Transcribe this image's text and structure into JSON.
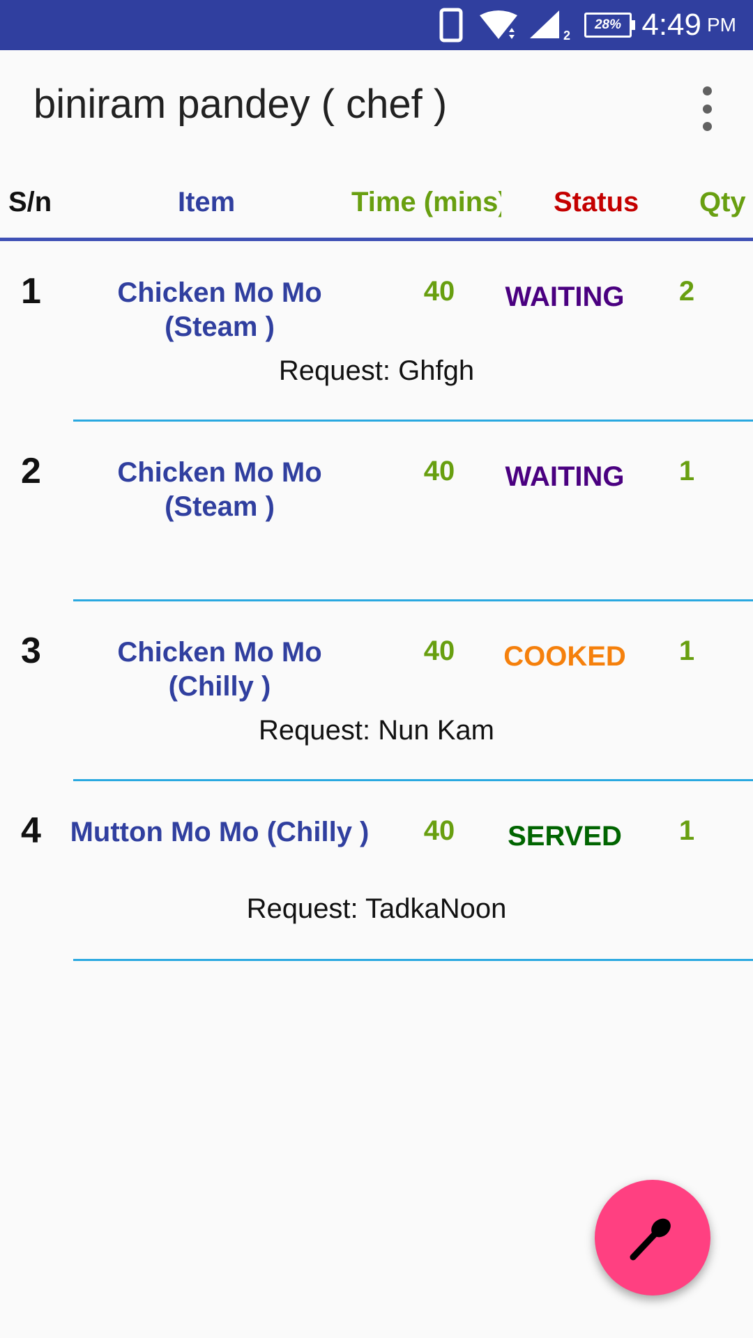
{
  "status_bar": {
    "battery": "28%",
    "time": "4:49",
    "ampm": "PM",
    "signal_sub": "2",
    "bg_color": "#303F9F"
  },
  "app_bar": {
    "title": "biniram pandey ( chef )",
    "overflow_icon": "more-vert-icon"
  },
  "table": {
    "headers": {
      "sn": "S/n",
      "item": "Item",
      "time": "Time (mins)",
      "status": "Status",
      "qty": "Qty"
    },
    "header_colors": {
      "sn": "#111111",
      "item": "#303F9F",
      "time": "#689F10",
      "status": "#C40000",
      "qty": "#689F10"
    },
    "rows": [
      {
        "sn": "1",
        "item_line1": "Chicken Mo Mo",
        "item_line2": "(Steam )",
        "time": "40",
        "status": "WAITING",
        "status_color": "#4A0080",
        "qty": "2",
        "request": "Request: Ghfgh"
      },
      {
        "sn": "2",
        "item_line1": "Chicken Mo Mo",
        "item_line2": "(Steam )",
        "time": "40",
        "status": "WAITING",
        "status_color": "#4A0080",
        "qty": "1",
        "request": ""
      },
      {
        "sn": "3",
        "item_line1": "Chicken Mo Mo",
        "item_line2": "(Chilly )",
        "time": "40",
        "status": "COOKED",
        "status_color": "#F5800C",
        "qty": "1",
        "request": "Request: Nun Kam"
      },
      {
        "sn": "4",
        "item_line1": "Mutton Mo Mo (Chilly )",
        "item_line2": "",
        "time": "40",
        "status": "SERVED",
        "status_color": "#006400",
        "qty": "1",
        "request": "Request: TadkaNoon"
      }
    ]
  },
  "fab": {
    "icon": "spoon-icon",
    "color": "#FF4081"
  }
}
